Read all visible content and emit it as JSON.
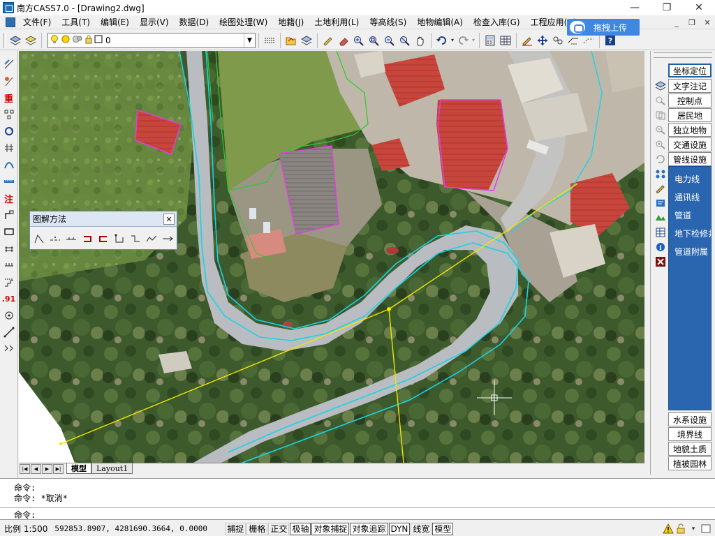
{
  "window": {
    "title": "南方CASS7.0 - [Drawing2.dwg]",
    "controls": {
      "minimize": "—",
      "maximize": "❐",
      "close": "✕"
    }
  },
  "menu": {
    "items": [
      "文件(F)",
      "工具(T)",
      "编辑(E)",
      "显示(V)",
      "数据(D)",
      "绘图处理(W)",
      "地籍(J)",
      "土地利用(L)",
      "等高线(S)",
      "地物编辑(A)",
      "检查入库(G)",
      "工程应用(C)"
    ],
    "mdi_controls": {
      "minimize": "_",
      "restore": "❐",
      "close": "✕"
    }
  },
  "cloud_upload": {
    "label": "拖拽上传"
  },
  "layer": {
    "current": "0"
  },
  "float_toolbox": {
    "title": "图解方法",
    "close": "✕"
  },
  "tabs": {
    "model": "模型",
    "layout1": "Layout1"
  },
  "right_panel": {
    "top_buttons": [
      "坐标定位",
      "文字注记",
      "控制点",
      "居民地",
      "独立地物",
      "交通设施",
      "管线设施"
    ],
    "list_items": [
      "电力线",
      "通讯线",
      "管道",
      "地下检修井",
      "管道附属"
    ],
    "bottom_buttons": [
      "水系设施",
      "境界线",
      "地貌土质",
      "植被园林"
    ]
  },
  "command": {
    "line1": "命令:",
    "line2": "命令: *取消*",
    "prompt": "命令:"
  },
  "status": {
    "scale": "比例  1:500",
    "coords": "592853.8907, 4281690.3664, 0.0000",
    "toggles": [
      {
        "label": "捕捉",
        "on": false
      },
      {
        "label": "栅格",
        "on": false
      },
      {
        "label": "正交",
        "on": false
      },
      {
        "label": "极轴",
        "on": true
      },
      {
        "label": "对象捕捉",
        "on": true
      },
      {
        "label": "对象追踪",
        "on": true
      },
      {
        "label": "DYN",
        "on": true
      },
      {
        "label": "线宽",
        "on": false
      },
      {
        "label": "模型",
        "on": true
      }
    ]
  },
  "icons": {
    "toolbar": [
      "layers-icon",
      "layer-state-icon",
      "lightbulb-icon",
      "sun-icon",
      "lock-icon",
      "square-icon",
      "linetype-icon",
      "open-folder-icon",
      "pencil-icon",
      "eraser-icon",
      "zoom-realtime-icon",
      "zoom-window-icon",
      "zoom-previous-icon",
      "pan-icon",
      "undo-icon",
      "redo-icon",
      "calculator-icon",
      "grid-icon",
      "edit-icon",
      "move-icon",
      "link-icon",
      "polyline-icon",
      "help-icon"
    ]
  }
}
